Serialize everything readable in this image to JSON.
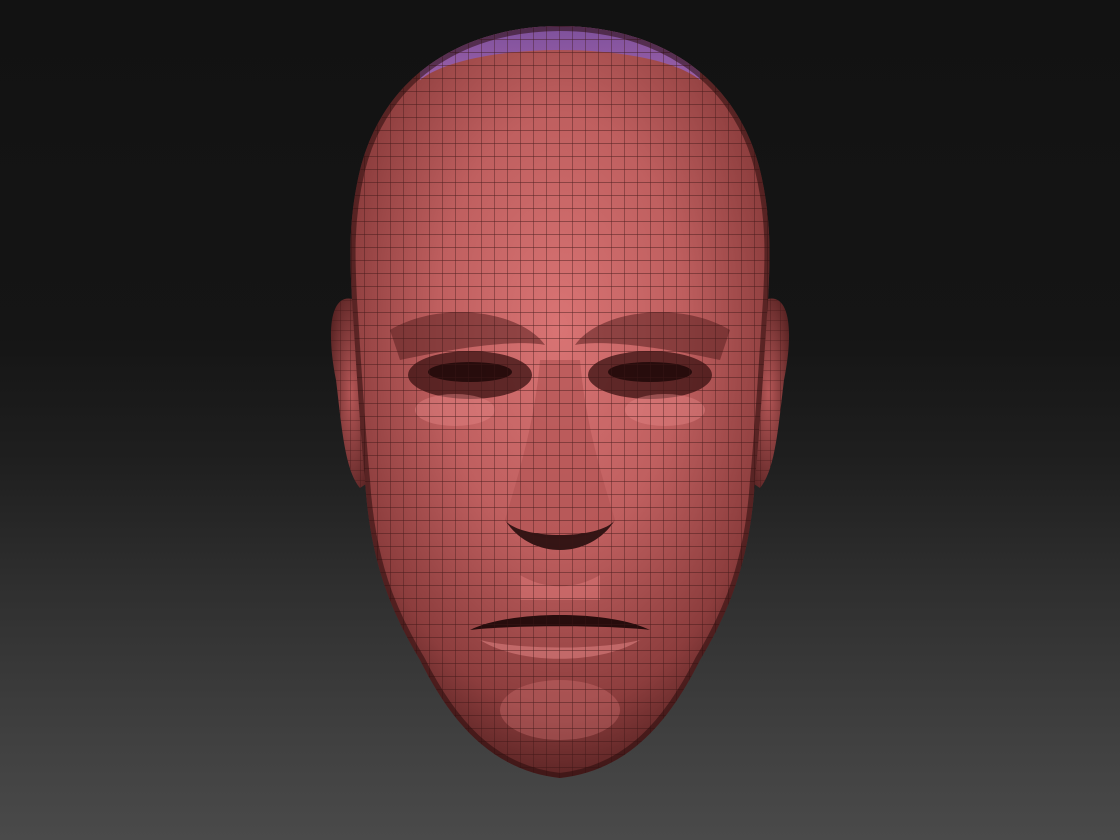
{
  "viewport": {
    "background_top": "#121212",
    "background_bottom": "#4a4a4a"
  },
  "model": {
    "type": "head-mesh",
    "material_color": "#b85a5a",
    "masked_region_color": "#8a55a0",
    "wire_color": "#3a1414"
  }
}
